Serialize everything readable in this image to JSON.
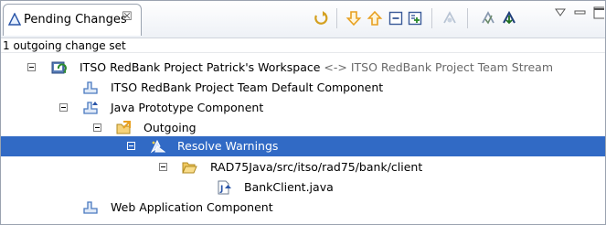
{
  "view": {
    "title": "Pending Changes",
    "close_glyph": "☒"
  },
  "status": "1 outgoing change set",
  "tree": {
    "workspace": {
      "label": "ITSO RedBank Project Patrick's Workspace",
      "suffix": " <-> ITSO RedBank Project Team Stream"
    },
    "default_component": {
      "label": "ITSO RedBank Project Team Default Component"
    },
    "java_component": {
      "label": "Java Prototype Component"
    },
    "outgoing": {
      "label": "Outgoing"
    },
    "change_set": {
      "label": "Resolve Warnings"
    },
    "folder": {
      "label": "RAD75Java/src/itso/rad75/bank/client"
    },
    "file": {
      "label": "BankClient.java"
    },
    "web_component": {
      "label": "Web Application Component"
    }
  },
  "toolbar_icons": [
    "refresh-icon",
    "expand-down-icon",
    "collapse-up-icon",
    "collapse-all-icon",
    "expand-all-icon",
    "next-disabled-icon",
    "accept-icon",
    "deliver-icon",
    "view-menu-icon",
    "minimize-icon",
    "maximize-icon"
  ],
  "colors": {
    "selection": "#316ac5",
    "suffix_text": "#6a6a6a",
    "arrow_orange": "#e8a020"
  }
}
